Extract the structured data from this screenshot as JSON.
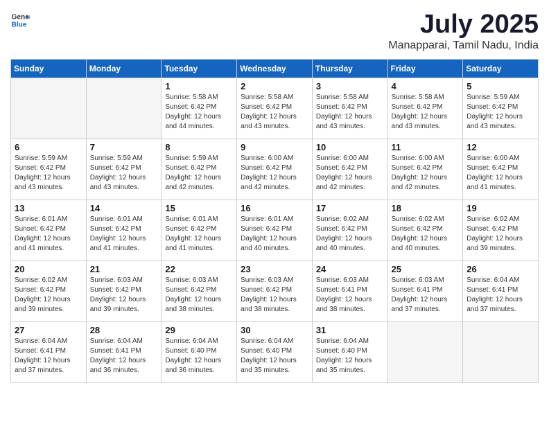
{
  "header": {
    "logo_general": "General",
    "logo_blue": "Blue",
    "title": "July 2025",
    "subtitle": "Manapparai, Tamil Nadu, India"
  },
  "weekdays": [
    "Sunday",
    "Monday",
    "Tuesday",
    "Wednesday",
    "Thursday",
    "Friday",
    "Saturday"
  ],
  "weeks": [
    [
      {
        "day": "",
        "sunrise": "",
        "sunset": "",
        "daylight": "",
        "empty": true
      },
      {
        "day": "",
        "sunrise": "",
        "sunset": "",
        "daylight": "",
        "empty": true
      },
      {
        "day": "1",
        "sunrise": "Sunrise: 5:58 AM",
        "sunset": "Sunset: 6:42 PM",
        "daylight": "Daylight: 12 hours and 44 minutes.",
        "empty": false
      },
      {
        "day": "2",
        "sunrise": "Sunrise: 5:58 AM",
        "sunset": "Sunset: 6:42 PM",
        "daylight": "Daylight: 12 hours and 43 minutes.",
        "empty": false
      },
      {
        "day": "3",
        "sunrise": "Sunrise: 5:58 AM",
        "sunset": "Sunset: 6:42 PM",
        "daylight": "Daylight: 12 hours and 43 minutes.",
        "empty": false
      },
      {
        "day": "4",
        "sunrise": "Sunrise: 5:58 AM",
        "sunset": "Sunset: 6:42 PM",
        "daylight": "Daylight: 12 hours and 43 minutes.",
        "empty": false
      },
      {
        "day": "5",
        "sunrise": "Sunrise: 5:59 AM",
        "sunset": "Sunset: 6:42 PM",
        "daylight": "Daylight: 12 hours and 43 minutes.",
        "empty": false
      }
    ],
    [
      {
        "day": "6",
        "sunrise": "Sunrise: 5:59 AM",
        "sunset": "Sunset: 6:42 PM",
        "daylight": "Daylight: 12 hours and 43 minutes.",
        "empty": false
      },
      {
        "day": "7",
        "sunrise": "Sunrise: 5:59 AM",
        "sunset": "Sunset: 6:42 PM",
        "daylight": "Daylight: 12 hours and 43 minutes.",
        "empty": false
      },
      {
        "day": "8",
        "sunrise": "Sunrise: 5:59 AM",
        "sunset": "Sunset: 6:42 PM",
        "daylight": "Daylight: 12 hours and 42 minutes.",
        "empty": false
      },
      {
        "day": "9",
        "sunrise": "Sunrise: 6:00 AM",
        "sunset": "Sunset: 6:42 PM",
        "daylight": "Daylight: 12 hours and 42 minutes.",
        "empty": false
      },
      {
        "day": "10",
        "sunrise": "Sunrise: 6:00 AM",
        "sunset": "Sunset: 6:42 PM",
        "daylight": "Daylight: 12 hours and 42 minutes.",
        "empty": false
      },
      {
        "day": "11",
        "sunrise": "Sunrise: 6:00 AM",
        "sunset": "Sunset: 6:42 PM",
        "daylight": "Daylight: 12 hours and 42 minutes.",
        "empty": false
      },
      {
        "day": "12",
        "sunrise": "Sunrise: 6:00 AM",
        "sunset": "Sunset: 6:42 PM",
        "daylight": "Daylight: 12 hours and 41 minutes.",
        "empty": false
      }
    ],
    [
      {
        "day": "13",
        "sunrise": "Sunrise: 6:01 AM",
        "sunset": "Sunset: 6:42 PM",
        "daylight": "Daylight: 12 hours and 41 minutes.",
        "empty": false
      },
      {
        "day": "14",
        "sunrise": "Sunrise: 6:01 AM",
        "sunset": "Sunset: 6:42 PM",
        "daylight": "Daylight: 12 hours and 41 minutes.",
        "empty": false
      },
      {
        "day": "15",
        "sunrise": "Sunrise: 6:01 AM",
        "sunset": "Sunset: 6:42 PM",
        "daylight": "Daylight: 12 hours and 41 minutes.",
        "empty": false
      },
      {
        "day": "16",
        "sunrise": "Sunrise: 6:01 AM",
        "sunset": "Sunset: 6:42 PM",
        "daylight": "Daylight: 12 hours and 40 minutes.",
        "empty": false
      },
      {
        "day": "17",
        "sunrise": "Sunrise: 6:02 AM",
        "sunset": "Sunset: 6:42 PM",
        "daylight": "Daylight: 12 hours and 40 minutes.",
        "empty": false
      },
      {
        "day": "18",
        "sunrise": "Sunrise: 6:02 AM",
        "sunset": "Sunset: 6:42 PM",
        "daylight": "Daylight: 12 hours and 40 minutes.",
        "empty": false
      },
      {
        "day": "19",
        "sunrise": "Sunrise: 6:02 AM",
        "sunset": "Sunset: 6:42 PM",
        "daylight": "Daylight: 12 hours and 39 minutes.",
        "empty": false
      }
    ],
    [
      {
        "day": "20",
        "sunrise": "Sunrise: 6:02 AM",
        "sunset": "Sunset: 6:42 PM",
        "daylight": "Daylight: 12 hours and 39 minutes.",
        "empty": false
      },
      {
        "day": "21",
        "sunrise": "Sunrise: 6:03 AM",
        "sunset": "Sunset: 6:42 PM",
        "daylight": "Daylight: 12 hours and 39 minutes.",
        "empty": false
      },
      {
        "day": "22",
        "sunrise": "Sunrise: 6:03 AM",
        "sunset": "Sunset: 6:42 PM",
        "daylight": "Daylight: 12 hours and 38 minutes.",
        "empty": false
      },
      {
        "day": "23",
        "sunrise": "Sunrise: 6:03 AM",
        "sunset": "Sunset: 6:42 PM",
        "daylight": "Daylight: 12 hours and 38 minutes.",
        "empty": false
      },
      {
        "day": "24",
        "sunrise": "Sunrise: 6:03 AM",
        "sunset": "Sunset: 6:41 PM",
        "daylight": "Daylight: 12 hours and 38 minutes.",
        "empty": false
      },
      {
        "day": "25",
        "sunrise": "Sunrise: 6:03 AM",
        "sunset": "Sunset: 6:41 PM",
        "daylight": "Daylight: 12 hours and 37 minutes.",
        "empty": false
      },
      {
        "day": "26",
        "sunrise": "Sunrise: 6:04 AM",
        "sunset": "Sunset: 6:41 PM",
        "daylight": "Daylight: 12 hours and 37 minutes.",
        "empty": false
      }
    ],
    [
      {
        "day": "27",
        "sunrise": "Sunrise: 6:04 AM",
        "sunset": "Sunset: 6:41 PM",
        "daylight": "Daylight: 12 hours and 37 minutes.",
        "empty": false
      },
      {
        "day": "28",
        "sunrise": "Sunrise: 6:04 AM",
        "sunset": "Sunset: 6:41 PM",
        "daylight": "Daylight: 12 hours and 36 minutes.",
        "empty": false
      },
      {
        "day": "29",
        "sunrise": "Sunrise: 6:04 AM",
        "sunset": "Sunset: 6:40 PM",
        "daylight": "Daylight: 12 hours and 36 minutes.",
        "empty": false
      },
      {
        "day": "30",
        "sunrise": "Sunrise: 6:04 AM",
        "sunset": "Sunset: 6:40 PM",
        "daylight": "Daylight: 12 hours and 35 minutes.",
        "empty": false
      },
      {
        "day": "31",
        "sunrise": "Sunrise: 6:04 AM",
        "sunset": "Sunset: 6:40 PM",
        "daylight": "Daylight: 12 hours and 35 minutes.",
        "empty": false
      },
      {
        "day": "",
        "sunrise": "",
        "sunset": "",
        "daylight": "",
        "empty": true
      },
      {
        "day": "",
        "sunrise": "",
        "sunset": "",
        "daylight": "",
        "empty": true
      }
    ]
  ]
}
